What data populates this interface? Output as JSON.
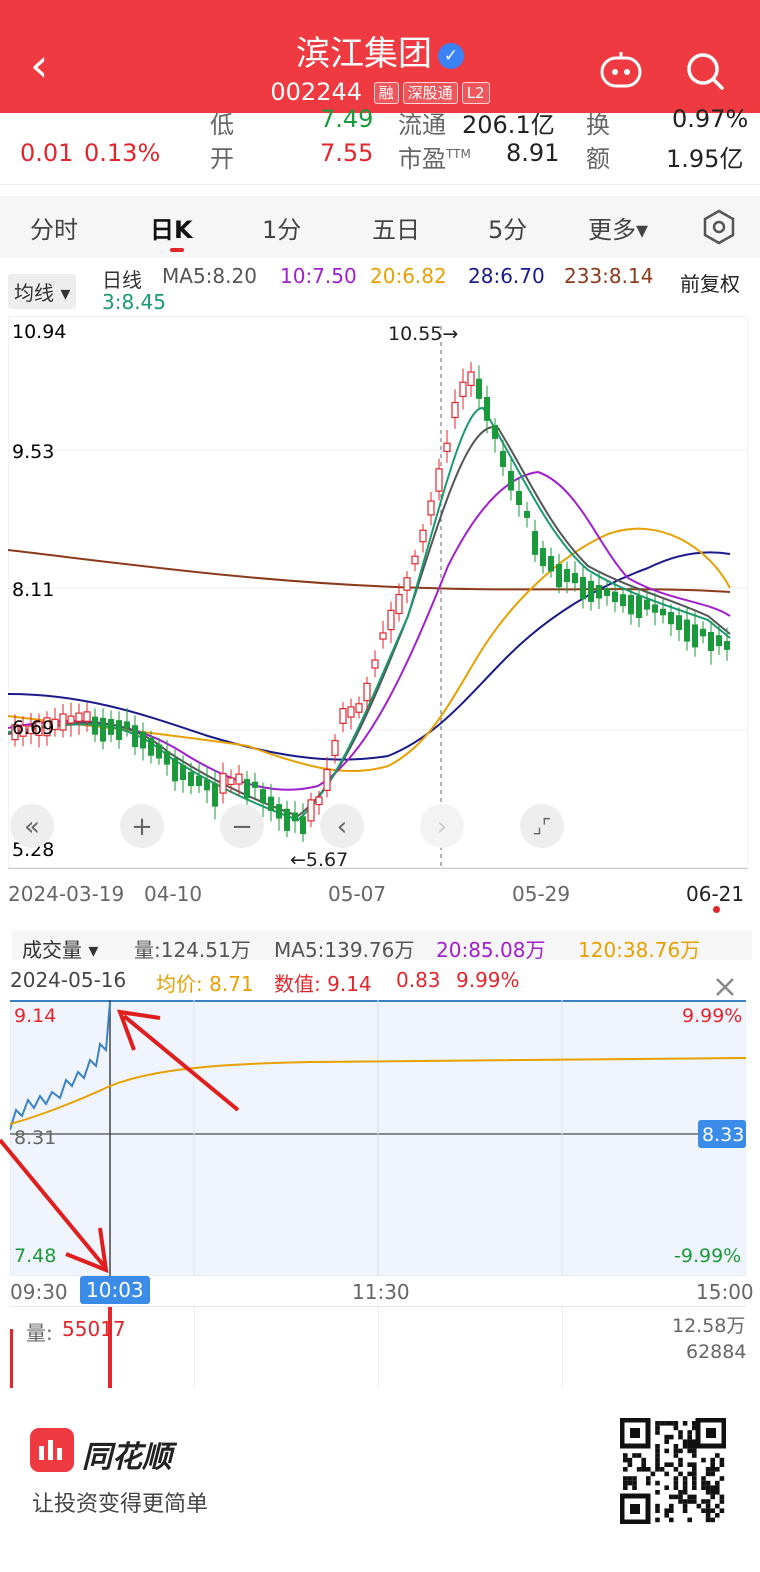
{
  "header": {
    "back_icon": "chevron-left-icon",
    "title": "滨江集团",
    "verified_icon": "verified-check-icon",
    "code": "002244",
    "tags": [
      "融",
      "深股通",
      "L2"
    ],
    "robot_icon": "robot-assistant-icon",
    "search_icon": "search-icon",
    "color": "#ee3a40"
  },
  "quote": {
    "change": "0.01",
    "change_pct": "0.13%",
    "low_label": "低",
    "low_value": "7.49",
    "open_label": "开",
    "open_value": "7.55",
    "float_label": "流通",
    "float_value": "206.1亿",
    "pe_label": "市盈",
    "pe_sup": "TTM",
    "pe_value": "8.91",
    "turnover_label": "换",
    "turnover_value": "0.97%",
    "amount_label": "额",
    "amount_value": "1.95亿"
  },
  "tabs": {
    "items": [
      "分时",
      "日K",
      "1分",
      "五日",
      "5分",
      "更多▾"
    ],
    "active": "日K",
    "settings_icon": "hexagon-settings-icon"
  },
  "ma_bar": {
    "selector": "均线 ▾",
    "label": "日线",
    "ma5": "MA5:8.20",
    "ma10": "10:7.50",
    "ma20": "20:6.82",
    "ma28": "28:6.70",
    "ma233": "233:8.14",
    "ma3": "3:8.45",
    "adjust": "前复权"
  },
  "kline": {
    "y_labels": [
      "10.94",
      "9.53",
      "8.11",
      "6.69",
      "5.28"
    ],
    "x_labels": [
      "2024-03-19",
      "04-10",
      "05-07",
      "05-29",
      "06-21"
    ],
    "high_marker": "10.55→",
    "low_marker": "←5.67",
    "controls": [
      "«",
      "+",
      "−",
      "‹",
      "›",
      "⌟⌜"
    ],
    "colors": {
      "up": "#e3262c",
      "down": "#1a9a3a",
      "ma5": "#555555",
      "ma10": "#a020d0",
      "ma20": "#e8a000",
      "ma28": "#1a1a8c",
      "ma233": "#8b3a1a",
      "ma3": "#1a9a70"
    }
  },
  "volume_bar": {
    "selector": "成交量 ▾",
    "vol": "量:124.51万",
    "ma5": "MA5:139.76万",
    "ma20": "20:85.08万",
    "ma120": "120:38.76万"
  },
  "intraday": {
    "date": "2024-05-16",
    "avg_label": "均价:",
    "avg_value": "8.71",
    "val_label": "数值:",
    "val_value": "9.14",
    "chg": "0.83",
    "chg_pct": "9.99%",
    "close_icon": "close-icon",
    "top_price": "9.14",
    "top_pct": "9.99%",
    "mid_price": "8.31",
    "mid_tag": "8.33",
    "bot_price": "7.48",
    "bot_pct": "-9.99%",
    "times": [
      "09:30",
      "10:03",
      "11:30",
      "15:00"
    ],
    "vol_label": "量:",
    "vol_value": "55017",
    "vol_max": "12.58万",
    "vol_mid": "62884"
  },
  "footer": {
    "brand": "同花顺",
    "slogan": "让投资变得更简单",
    "logo_icon": "tonghuashun-logo-icon",
    "qr_icon": "qr-code-icon"
  }
}
